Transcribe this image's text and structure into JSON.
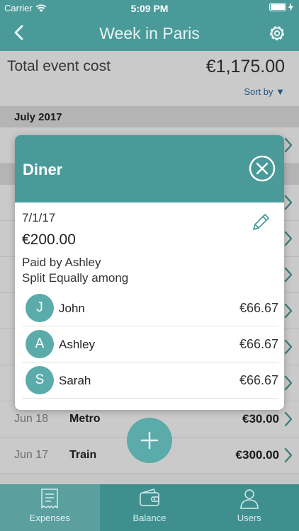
{
  "status": {
    "carrier": "Carrier",
    "time": "5:09 PM",
    "battery_level": 1.0
  },
  "nav": {
    "title": "Week in Paris",
    "back_icon": "chevron-left-icon",
    "settings_icon": "gear-icon"
  },
  "summary": {
    "label": "Total event cost",
    "amount": "€1,175.00",
    "sort_label": "Sort by ▼"
  },
  "section": {
    "label": "July 2017"
  },
  "expenses": [
    {
      "date": "Jun 18",
      "name": "Metro",
      "cost": "€30.00"
    },
    {
      "date": "Jun 17",
      "name": "Train",
      "cost": "€300.00"
    }
  ],
  "modal": {
    "title": "Diner",
    "date": "7/1/17",
    "amount": "€200.00",
    "paid_by": "Paid by Ashley",
    "split": "Split Equally among",
    "members": [
      {
        "initial": "J",
        "name": "John",
        "share": "€66.67"
      },
      {
        "initial": "A",
        "name": "Ashley",
        "share": "€66.67"
      },
      {
        "initial": "S",
        "name": "Sarah",
        "share": "€66.67"
      }
    ]
  },
  "tabs": [
    {
      "label": "Expenses",
      "icon": "receipt-icon"
    },
    {
      "label": "Balance",
      "icon": "wallet-icon"
    },
    {
      "label": "Users",
      "icon": "user-icon"
    }
  ],
  "colors": {
    "teal": "#4a9a9a",
    "teal_light": "#5cabab",
    "tabbar": "#3f8f8f"
  }
}
